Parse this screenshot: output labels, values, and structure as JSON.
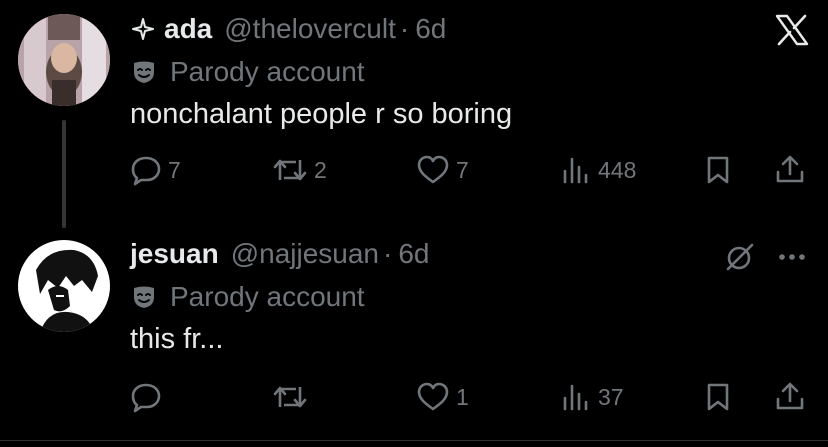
{
  "tweets": [
    {
      "name": "ada",
      "handle": "@thelovercult",
      "time": "6d",
      "badge": "Parody account",
      "text": "nonchalant people r so boring",
      "replies": "7",
      "reposts": "2",
      "likes": "7",
      "views": "448",
      "top_right_icon": "x-logo-icon"
    },
    {
      "name": "jesuan",
      "handle": "@najjesuan",
      "time": "6d",
      "badge": "Parody account",
      "text": "this fr...",
      "replies": "",
      "reposts": "",
      "likes": "1",
      "views": "37",
      "top_right_icon": "grok-icon"
    }
  ],
  "separator": "·",
  "colors": {
    "background": "#000000",
    "primary_text": "#e7e9ea",
    "secondary_text": "#71767b",
    "thread_line": "#333639"
  }
}
